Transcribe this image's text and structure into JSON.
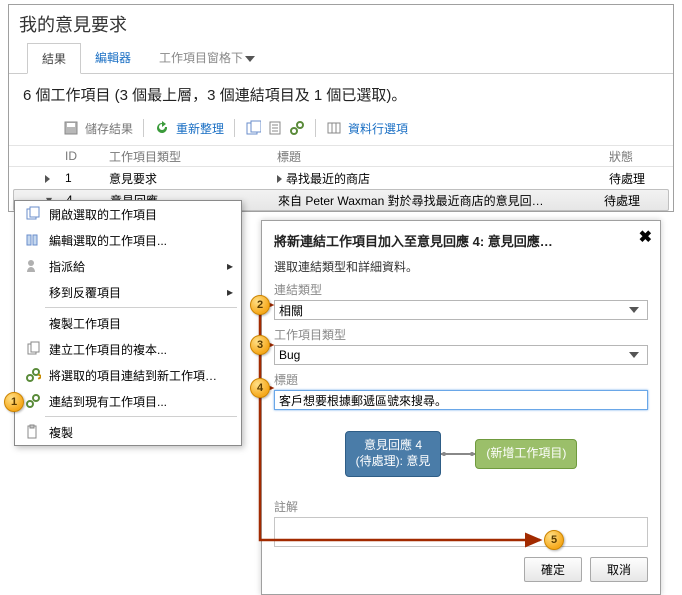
{
  "window": {
    "title": "我的意見要求"
  },
  "tabs": {
    "results": "結果",
    "editor": "編輯器",
    "tools": "工作項目窗格下"
  },
  "summary": "6 個工作項目 (3 個最上層，3 個連結項目及 1 個已選取)。",
  "toolbar": {
    "save": "儲存結果",
    "refresh": "重新整理",
    "columns": "資料行選項"
  },
  "grid": {
    "headers": {
      "id": "ID",
      "type": "工作項目類型",
      "title": "標題",
      "state": "狀態"
    },
    "rows": [
      {
        "id": "1",
        "type": "意見要求",
        "expand": "tri",
        "title": "尋找最近的商店",
        "state": "待處理"
      },
      {
        "id": "4",
        "type": "意見回應",
        "expand": "",
        "title": "來自 Peter Waxman 對於尋找最近商店的意見回…",
        "state": "待處理"
      }
    ]
  },
  "context_menu": {
    "items": [
      {
        "label": "開啟選取的工作項目",
        "icon": "open"
      },
      {
        "label": "編輯選取的工作項目...",
        "icon": "edit"
      },
      {
        "label": "指派給",
        "icon": "assign",
        "submenu": true
      },
      {
        "label": "移到反覆項目",
        "icon": "",
        "submenu": true
      },
      {
        "sep": true
      },
      {
        "label": "複製工作項目",
        "icon": ""
      },
      {
        "label": "建立工作項目的複本...",
        "icon": "copy"
      },
      {
        "label": "將選取的項目連結到新工作項…",
        "icon": "linknew"
      },
      {
        "label": "連結到現有工作項目...",
        "icon": "linkexist"
      },
      {
        "sep": true
      },
      {
        "label": "複製",
        "icon": "clipboard"
      }
    ]
  },
  "dialog": {
    "title": "將新連結工作項目加入至意見回應 4: 意見回應…",
    "subtitle": "選取連結類型和詳細資料。",
    "link_type_label": "連結類型",
    "link_type_value": "相關",
    "work_item_type_label": "工作項目類型",
    "work_item_type_value": "Bug",
    "title_label": "標題",
    "title_value": "客戶想要根據郵遞區號來搜尋。",
    "node_left_l1": "意見回應 4",
    "node_left_l2": "(待處理): 意見",
    "node_right": "(新增工作項目)",
    "notes_label": "註解",
    "ok": "確定",
    "cancel": "取消"
  },
  "callouts": {
    "c1": "1",
    "c2": "2",
    "c3": "3",
    "c4": "4",
    "c5": "5"
  }
}
